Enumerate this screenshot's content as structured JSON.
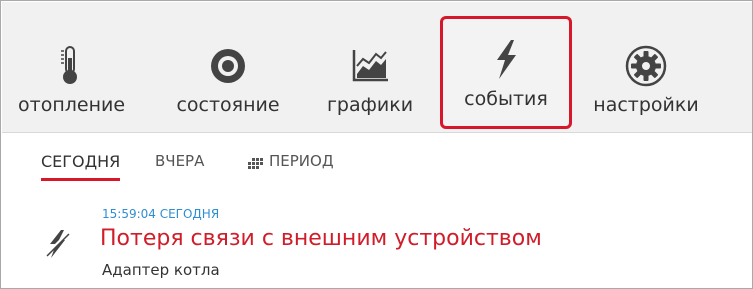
{
  "nav": {
    "tabs": [
      {
        "label": "отопление",
        "icon": "thermometer-icon"
      },
      {
        "label": "состояние",
        "icon": "target-icon"
      },
      {
        "label": "графики",
        "icon": "chart-icon"
      },
      {
        "label": "события",
        "icon": "lightning-icon",
        "active": true
      },
      {
        "label": "настройки",
        "icon": "gear-icon"
      }
    ]
  },
  "subtabs": {
    "today": "Сегодня",
    "yesterday": "Вчера",
    "period": "Период"
  },
  "event": {
    "time": "15:59:04 Сегодня",
    "title": "Потеря связи с внешним устройством",
    "subtitle": "Адаптер котла",
    "icon": "no-power-icon"
  },
  "colors": {
    "accent": "#d6182a",
    "time": "#2f8ed1",
    "event_title": "#d01d2a"
  }
}
